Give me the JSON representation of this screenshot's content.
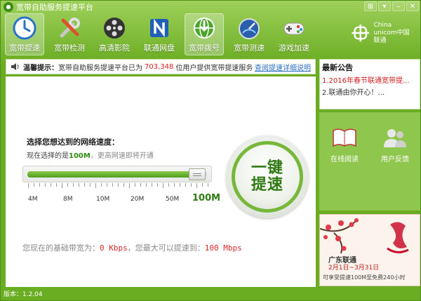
{
  "window": {
    "title": "宽带自助服务提速平台",
    "controls": [
      "⊞",
      "▾",
      "–",
      "✕"
    ]
  },
  "toolbar": [
    {
      "label": "宽带提速",
      "icon": "clock-icon",
      "active": true
    },
    {
      "label": "宽带检测",
      "icon": "tools-icon",
      "active": false
    },
    {
      "label": "高清影院",
      "icon": "film-reel-icon",
      "active": false
    },
    {
      "label": "联通网盘",
      "icon": "netdisk-icon",
      "active": false
    },
    {
      "label": "宽带拨号",
      "icon": "globe-icon",
      "active": true
    },
    {
      "label": "宽带测速",
      "icon": "speedometer-icon",
      "active": false
    },
    {
      "label": "游戏加速",
      "icon": "gamepad-icon",
      "active": false
    }
  ],
  "brand": {
    "line1": "China",
    "line2": "unicom中国联通"
  },
  "notice": {
    "label": "温馨提示：",
    "text_before": "宽带自助服务提速平台已为",
    "count": "703,348",
    "text_after": "位用户提供宽带提速服务",
    "link": "查阅提速详细说明"
  },
  "speed": {
    "title": "选择您想达到的网络速度：",
    "current_prefix": "现在选择的是",
    "current_value": "100M",
    "current_suffix": "，更高网速即将开通",
    "slider_fraction": 0.93,
    "ticks": [
      "4M",
      "8M",
      "10M",
      "20M",
      "50M",
      "100M"
    ]
  },
  "boost_button": {
    "line1": "一键",
    "line2": "提速"
  },
  "bandwidth": {
    "prefix": "您现在的基础带宽为：",
    "base": "0 Kbps",
    "middle": "，您最大可以提速到：",
    "max": "100 Mbps"
  },
  "news": {
    "title": "最新公告",
    "items": [
      "1.2016年春节联通宽带提...",
      "2.联通由你开心！..."
    ]
  },
  "services": [
    {
      "label": "在线阅读",
      "icon": "book-icon"
    },
    {
      "label": "用户反馈",
      "icon": "users-icon"
    }
  ],
  "ad": {
    "title": "广东联通",
    "date": "2月1日~3月31日",
    "desc": "可享受提速100M至免费240小时"
  },
  "statusbar": {
    "version": "版本：1.2.04"
  }
}
